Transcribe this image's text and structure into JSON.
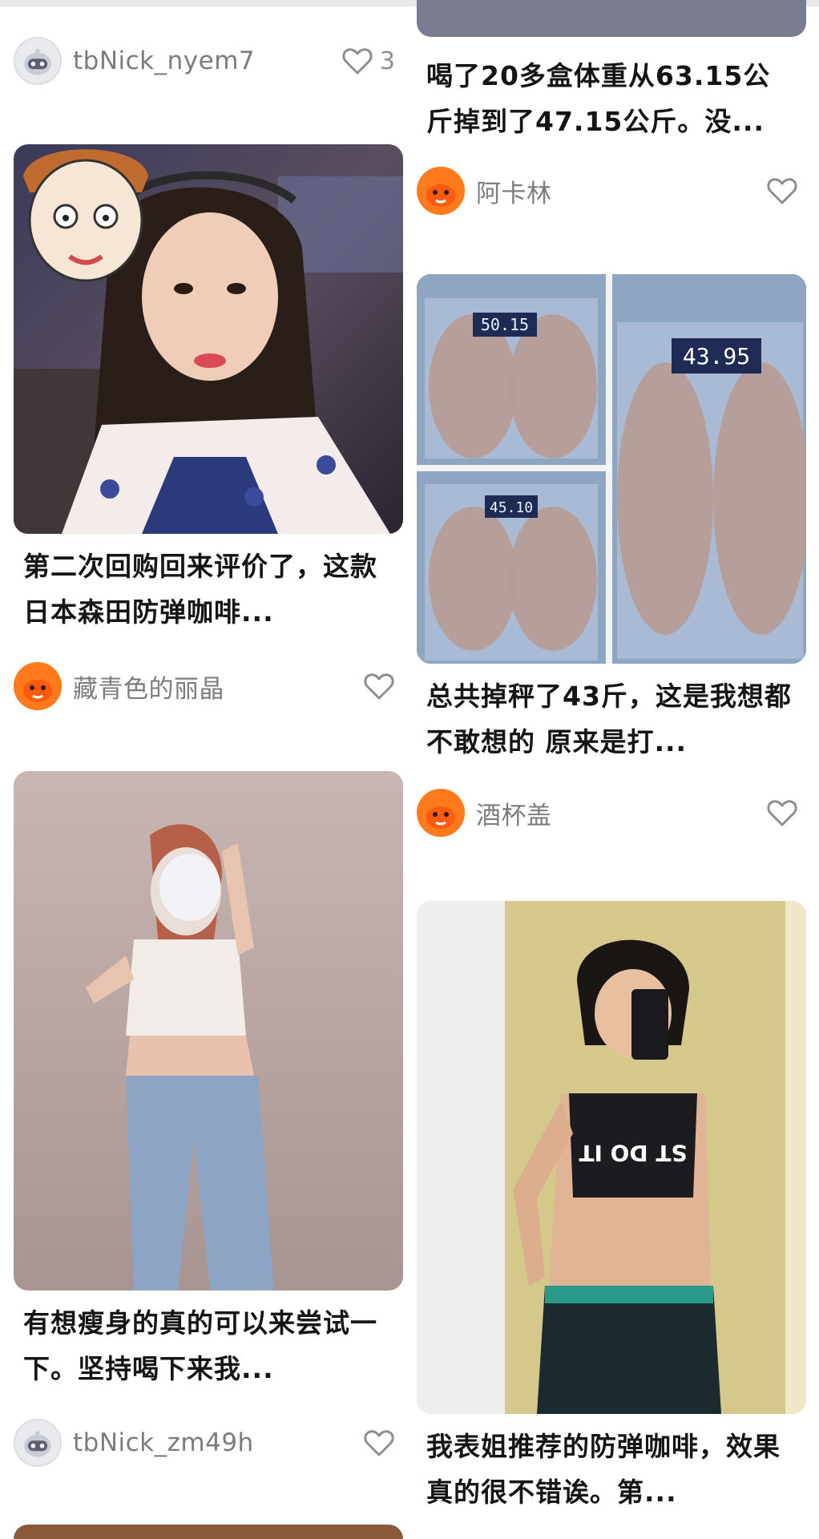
{
  "feed": {
    "left": [
      {
        "type": "user-only",
        "username": "tbNick_nyem7",
        "avatar": "robot-avatar",
        "likes": "3"
      },
      {
        "type": "post",
        "title": "第二次回购回来评价了，这款日本森田防弹咖啡...",
        "username": "藏青色的丽晶",
        "avatar": "fox-avatar",
        "likes": "",
        "image": "selfie-photo"
      },
      {
        "type": "post",
        "title": "有想瘦身的真的可以来尝试一下。坚持喝下来我...",
        "username": "tbNick_zm49h",
        "avatar": "robot-avatar",
        "likes": "",
        "image": "body-photo"
      }
    ],
    "right": [
      {
        "type": "post",
        "title": "喝了20多盒体重从63.15公斤掉到了47.15公斤。没...",
        "username": "阿卡林",
        "avatar": "fox-avatar",
        "likes": ""
      },
      {
        "type": "post",
        "title": "总共掉秤了43斤，这是我想都不敢想的 原来是打...",
        "username": "酒杯盖",
        "avatar": "fox-avatar",
        "likes": "",
        "image": "scale-collage",
        "scale_readings": [
          "50.15",
          "43.95",
          "45.10"
        ]
      },
      {
        "type": "post",
        "title": "我表姐推荐的防弹咖啡，效果真的很不错诶。第...",
        "username": "",
        "avatar": "",
        "likes": "",
        "image": "mirror-selfie",
        "shirt_text": "ST DO IT"
      }
    ]
  },
  "colors": {
    "accent": "#ff7a1a",
    "text": "#151515",
    "muted": "#7c7c7c",
    "heart": "#8e8e8e"
  }
}
